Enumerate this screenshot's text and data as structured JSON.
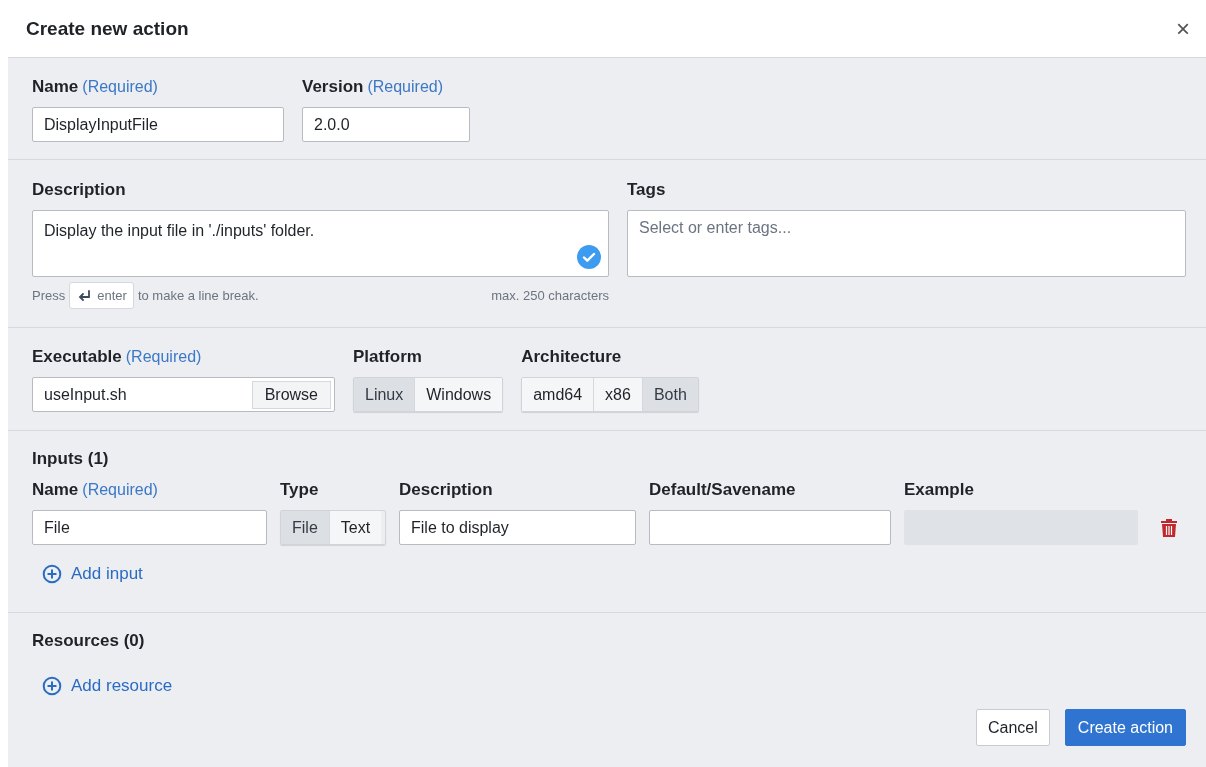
{
  "dialog": {
    "title": "Create new action",
    "close": "×"
  },
  "name": {
    "label": "Name",
    "required": "(Required)",
    "value": "DisplayInputFile"
  },
  "version": {
    "label": "Version",
    "required": "(Required)",
    "value": "2.0.0"
  },
  "description": {
    "label": "Description",
    "value": "Display the input file in './inputs' folder.",
    "valid": true,
    "hint_press": "Press",
    "hint_key": "enter",
    "hint_rest": "to make a line break.",
    "max": "max. 250 characters"
  },
  "tags": {
    "label": "Tags",
    "placeholder": "Select or enter tags..."
  },
  "executable": {
    "label": "Executable",
    "required": "(Required)",
    "value": "useInput.sh",
    "browse": "Browse"
  },
  "platform": {
    "label": "Platform",
    "options": [
      {
        "label": "Linux",
        "selected": true
      },
      {
        "label": "Windows",
        "selected": false
      }
    ]
  },
  "architecture": {
    "label": "Architecture",
    "options": [
      {
        "label": "amd64",
        "selected": false
      },
      {
        "label": "x86",
        "selected": false
      },
      {
        "label": "Both",
        "selected": true
      }
    ]
  },
  "inputs": {
    "title": "Inputs (1)",
    "columns": [
      {
        "label": "Name",
        "required": "(Required)"
      },
      {
        "label": "Type"
      },
      {
        "label": "Description"
      },
      {
        "label": "Default/Savename"
      },
      {
        "label": "Example"
      }
    ],
    "rows": [
      {
        "name": "File",
        "types": [
          {
            "label": "File",
            "selected": true
          },
          {
            "label": "Text",
            "selected": false
          }
        ],
        "description": "File to display"
      }
    ],
    "add": "Add input"
  },
  "resources": {
    "title": "Resources (0)",
    "add": "Add resource"
  },
  "buttons": [
    {
      "label": "Cancel",
      "kind": "secondary"
    },
    {
      "label": "Create action",
      "kind": "primary"
    }
  ]
}
